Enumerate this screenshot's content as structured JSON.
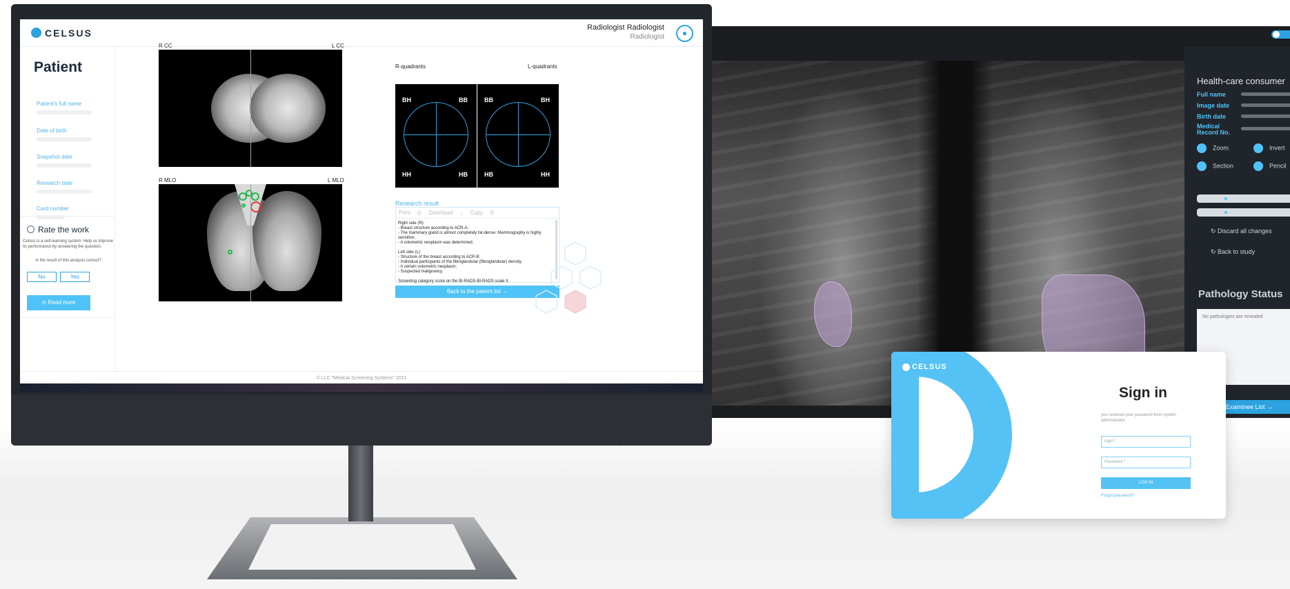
{
  "left_app": {
    "logo": "CELSUS",
    "user": {
      "name": "Radiologist Radiologist",
      "role": "Radiologist"
    },
    "sidebar": {
      "title": "Patient",
      "fields": [
        "Patient's full name",
        "Date of birth",
        "Snapshot date",
        "Research date",
        "Card number"
      ]
    },
    "rate": {
      "title": "Rate the work",
      "description": "Celsus is a self-learning system. Help us improve its performance by answering the question.",
      "question": "Is the result of this analysis correct?",
      "no": "No",
      "yes": "Yes",
      "read_more": "Read more"
    },
    "views": {
      "rcc": "R CC",
      "lcc": "L CC",
      "rmlo": "R MLO",
      "lmlo": "L MLO"
    },
    "quadrants": {
      "r_title": "R-quadrants",
      "l_title": "L-quadrants",
      "r_labels": [
        "BH",
        "BB",
        "HH",
        "HB"
      ],
      "l_labels": [
        "BB",
        "BH",
        "HB",
        "HH"
      ]
    },
    "research": {
      "title": "Research result",
      "tools": "Print ⎙ Download ↓ Copy ⎘",
      "text": "Right side (R):\n- Breast structure according to ACR-A;\n- The mammary gland is almost completely fat-dense. Mammography is highly sensitive;\n- A volumetric neoplasm was determined.\n\nLeft side (L):\n- Structure of the breast according to ACR-B;\n- Individual participants of the fibroglandular (fibroglandular) density;\n- A certain volumetric neoplasm;\n- Suspected malignancy.\n\nScreening category score on the BI-RADS-BI-RADS scale II.",
      "back_button": "Back to the patient list →"
    },
    "footer": "© LLC \"Medical Screening Systems\" 2021"
  },
  "right_app": {
    "panel_title": "Health-care consumer",
    "fields": [
      "Full name",
      "Image date",
      "Birth date",
      "Medical Record No."
    ],
    "tools": [
      "Zoom",
      "Invert",
      "Section",
      "Pencil"
    ],
    "discard": "↻ Discard all changes",
    "back_study": "↻ Back to study",
    "pathology_title": "Pathology Status",
    "pathology_text": "No pathologies are revealed",
    "examinee_button": "to Examinee List →"
  },
  "signin": {
    "logo": "CELSUS",
    "title": "Sign in",
    "subtitle": "you received your password from system administrator.",
    "login_placeholder": "login *",
    "password_placeholder": "Password *",
    "button": "LOG IN",
    "forgot": "Forgot password?"
  },
  "colors": {
    "accent": "#4fc3f7",
    "accent_dark": "#2ca3e0",
    "roi": "#bea0d2",
    "marker_green": "#22b84a",
    "marker_red": "#e53935"
  },
  "icons": [
    "user-icon",
    "rate-icon",
    "read-more-icon",
    "print-icon",
    "download-icon",
    "copy-icon",
    "eye-icon"
  ]
}
